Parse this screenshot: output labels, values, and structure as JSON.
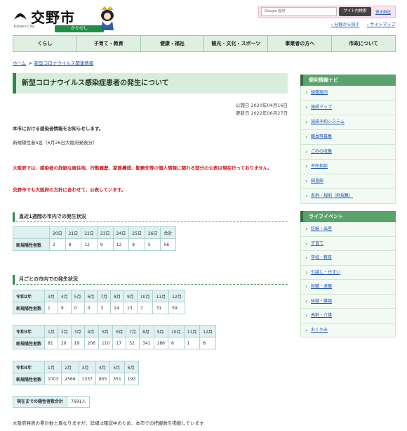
{
  "header": {
    "site_title": "交野市",
    "city_en": "Katano City",
    "city_kana": "かたのし",
    "search_placeholder": "Google 提供",
    "search_button": "サイト内検索",
    "settings_link": "表示設定",
    "link_find": "分野から探す",
    "link_map": "サイトマップ"
  },
  "nav": [
    "くらし",
    "子育て・教育",
    "健康・福祉",
    "観光・文化・スポーツ",
    "事業者の方へ",
    "市政について"
  ],
  "breadcrumb": {
    "home": "ホーム",
    "current": "新型コロナウイルス関連情報"
  },
  "page": {
    "title": "新型コロナウイルス感染症患者の発生について",
    "published": "公開日 2020年04月16日",
    "updated": "更新日 2022年06月27日",
    "intro": "本市における感染者情報をお知らせします。",
    "new_cases": "新規陽性者5名（6月26日大阪府発表分）",
    "notice1": "大阪府では、感染者の詳細な居住地、行動履歴、家族構成、勤務先等の個人情報に関わる部分の公表は現在行っておりません。",
    "notice2": "交野市でも大阪府の方針に合わせて、公表しています。"
  },
  "weekly": {
    "heading": "直近1週間の市内での発生状況",
    "days": [
      "20日",
      "21日",
      "22日",
      "23日",
      "24日",
      "25日",
      "26日",
      "合計"
    ],
    "row_label": "新規陽性者数",
    "values": [
      "2",
      "8",
      "12",
      "9",
      "12",
      "8",
      "5",
      "56"
    ]
  },
  "monthly": {
    "heading": "月ごとの市内での発生状況",
    "r2": {
      "label": "令和2年",
      "months": [
        "3月",
        "4月",
        "5月",
        "6月",
        "7月",
        "8月",
        "9月",
        "10月",
        "11月",
        "12月"
      ],
      "row_label": "新規陽性者数",
      "values": [
        "1",
        "9",
        "0",
        "0",
        "3",
        "14",
        "13",
        "7",
        "31",
        "59"
      ]
    },
    "r3": {
      "label": "令和3年",
      "months": [
        "1月",
        "2月",
        "3月",
        "4月",
        "5月",
        "6月",
        "7月",
        "8月",
        "9月",
        "10月",
        "11月",
        "12月"
      ],
      "row_label": "新規陽性者数",
      "values": [
        "81",
        "20",
        "19",
        "206",
        "110",
        "17",
        "52",
        "341",
        "186",
        "8",
        "1",
        "8"
      ]
    },
    "r4": {
      "label": "令和4年",
      "months": [
        "1月",
        "2月",
        "3月",
        "4月",
        "5月",
        "6月"
      ],
      "row_label": "新規陽性者数",
      "values": [
        "1003",
        "2566",
        "1337",
        "855",
        "551",
        "193"
      ]
    }
  },
  "total": {
    "label": "現在までの陽性者数合計",
    "value": "7691人"
  },
  "footnote": "大阪府発表の累計数と異なりますが、詳細は確認中のため、本市での把握数を掲載しています",
  "sidebar": {
    "nav_heading": "便利情報ナビ",
    "nav_items": [
      "組織案内",
      "施設マップ",
      "施設予約システム",
      "職員等募集",
      "ごみの収集",
      "市民相談",
      "図書館",
      "条例・規則（例規集）"
    ],
    "life_heading": "ライフイベント",
    "life_items": [
      "妊娠・出産",
      "子育て",
      "学校・教育",
      "引越し・住まい",
      "就職・退職",
      "結婚・離婚",
      "高齢・介護",
      "おくやみ"
    ]
  }
}
